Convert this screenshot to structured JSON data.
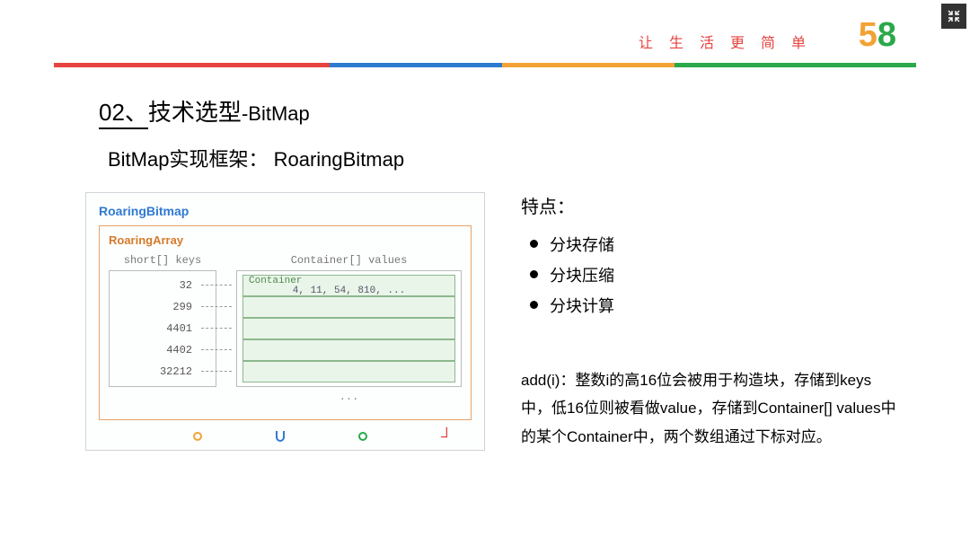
{
  "header": {
    "tagline": "让生活更简单",
    "logo_five": "5",
    "logo_eight": "8"
  },
  "title": {
    "num": "02、",
    "main": "技术选型",
    "sub": "-BitMap"
  },
  "subtitle": "BitMap实现框架： RoaringBitmap",
  "diagram": {
    "outer_label": "RoaringBitmap",
    "inner_label": "RoaringArray",
    "keys_label": "short[] keys",
    "values_label": "Container[] values",
    "keys": [
      "32",
      "299",
      "4401",
      "4402",
      "32212"
    ],
    "container_label": "Container",
    "container_values": "4, 11, 54, 810, ...",
    "ellipsis": "...",
    "watermark": ""
  },
  "features": {
    "title": "特点：",
    "items": [
      "分块存储",
      "分块压缩",
      "分块计算"
    ]
  },
  "description": "add(i)：整数i的高16位会被用于构造块，存储到keys中，低16位则被看做value，存储到Container[] values中的某个Container中，两个数组通过下标对应。",
  "expand_label": "⤢"
}
